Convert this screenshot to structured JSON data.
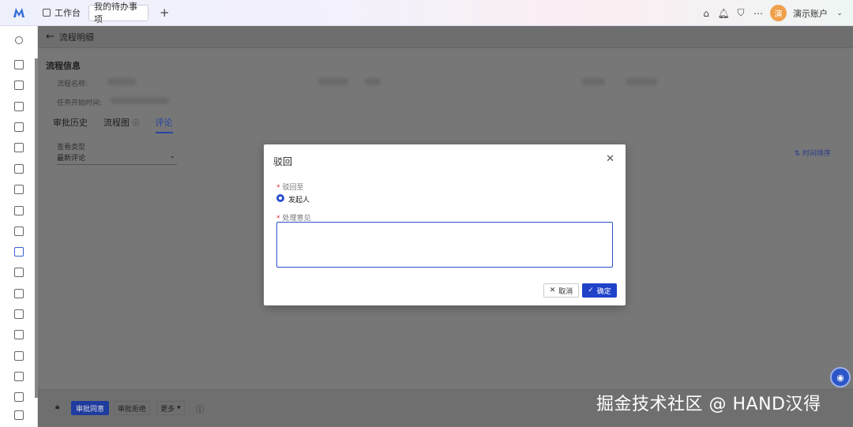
{
  "topbar": {
    "tabs": [
      {
        "label": "工作台"
      },
      {
        "label": "我的待办事项"
      }
    ],
    "user_initial": "演",
    "user_name": "演示账户"
  },
  "page": {
    "header_title": "流程明细",
    "section_title": "流程信息",
    "fields": [
      {
        "label": "流程名称:"
      },
      {
        "label": "任务开始时间:"
      }
    ],
    "tabs": [
      "审批历史",
      "流程图",
      "评论"
    ],
    "active_tab": "评论",
    "view_type_label": "查看类型",
    "view_type_value": "最新评论",
    "sort_link": "时间排序"
  },
  "footer": {
    "approve": "审批同意",
    "reject": "审批拒绝",
    "more": "更多"
  },
  "modal": {
    "title": "驳回",
    "reject_to_label": "驳回至",
    "reject_to_option": "发起人",
    "comment_label": "处理意见",
    "comment_value": "",
    "cancel": "取消",
    "confirm": "确定"
  },
  "watermark": "掘金技术社区 @ HAND汉得",
  "colors": {
    "primary": "#1f42c9",
    "required": "#e03030",
    "overlay": "#777777"
  }
}
